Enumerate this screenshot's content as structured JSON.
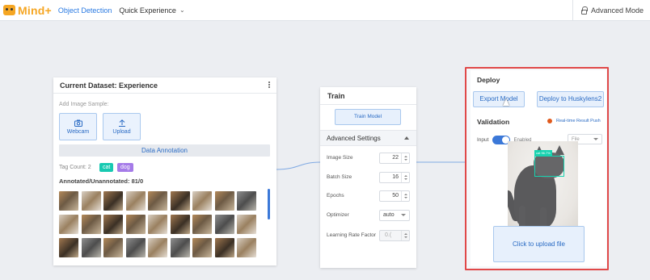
{
  "topbar": {
    "logo_text": "Mind+",
    "menu_object_detection": "Object Detection",
    "menu_quick_experience": "Quick Experience",
    "advanced_mode": "Advanced Mode"
  },
  "dataset": {
    "title": "Current Dataset: Experience",
    "add_sample_label": "Add Image Sample:",
    "webcam_label": "Webcam",
    "upload_label": "Upload",
    "annotation_label": "Data Annotation",
    "tag_count_label": "Tag Count: 2",
    "tags": [
      {
        "label": "cat",
        "color": "#17c9b1"
      },
      {
        "label": "dog",
        "color": "#a57be8"
      }
    ],
    "annotated_label": "Annotated/Unannotated: 81/0"
  },
  "train": {
    "title": "Train",
    "train_button": "Train Model",
    "advanced_settings": "Advanced Settings",
    "fields": [
      {
        "label": "Image Size",
        "value": "22"
      },
      {
        "label": "Batch Size",
        "value": "16"
      },
      {
        "label": "Epochs",
        "value": "50"
      },
      {
        "label": "Optimizer",
        "value": "auto"
      },
      {
        "label": "Learning Rate Factor",
        "value": "0.("
      }
    ]
  },
  "deploy": {
    "title": "Deploy",
    "export_button": "Export Model",
    "husky_button": "Deploy to Huskylens2",
    "validation_title": "Validation",
    "realtime_push": "Real-time Result Push",
    "input_label": "Input",
    "enabled_label": "Enabled",
    "select_value": "File",
    "bbox_label": "cat 96.7%",
    "upload_text": "Click to upload file"
  },
  "colors": {
    "accent": "#2a6bc4",
    "brand": "#f5a623",
    "highlight_border": "#e04848",
    "detection_box": "#18d3b0"
  }
}
